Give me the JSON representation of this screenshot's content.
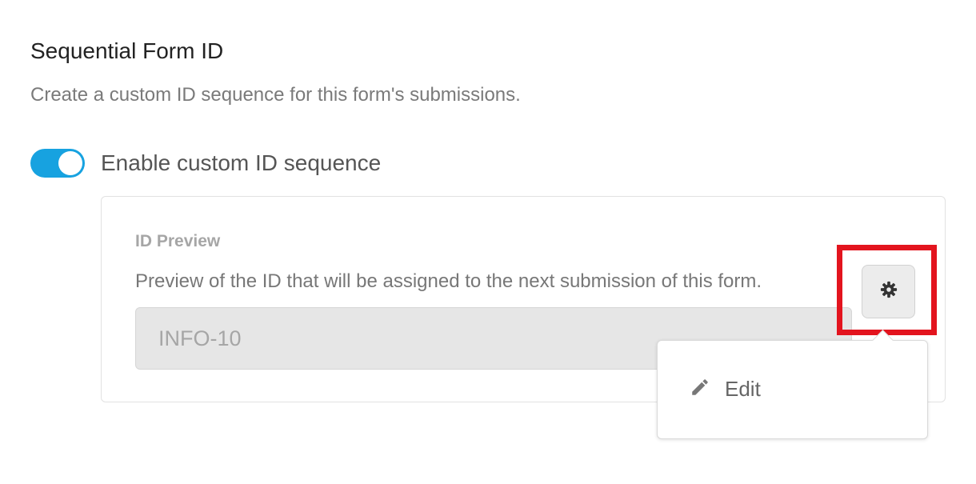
{
  "section": {
    "title": "Sequential Form ID",
    "description": "Create a custom ID sequence for this form's submissions."
  },
  "toggle": {
    "label": "Enable custom ID sequence",
    "enabled": true,
    "color": "#17a2e0"
  },
  "preview": {
    "heading": "ID Preview",
    "description": "Preview of the ID that will be assigned to the next submission of this form.",
    "value": "INFO-10"
  },
  "settings_button": {
    "icon": "gear-icon",
    "highlight_color": "#e3141e"
  },
  "dropdown": {
    "items": [
      {
        "label": "Edit",
        "icon": "pencil-icon"
      }
    ]
  }
}
